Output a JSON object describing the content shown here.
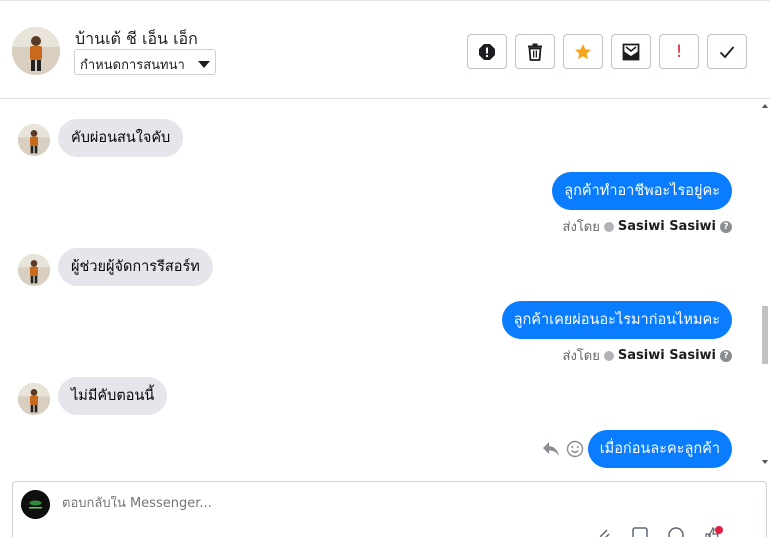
{
  "header": {
    "contact_name": "บ้านเต้ ชี เอ็น เอ็ก",
    "conversation_select": "กำหนดการสนทนา",
    "tools": [
      {
        "name": "spam-icon",
        "label": "!"
      },
      {
        "name": "trash-icon",
        "label": ""
      },
      {
        "name": "star-icon",
        "label": ""
      },
      {
        "name": "mark-unread-icon",
        "label": ""
      },
      {
        "name": "important-icon",
        "label": "!"
      },
      {
        "name": "done-icon",
        "label": ""
      }
    ]
  },
  "colors": {
    "accent": "#0a7cff",
    "incoming_bubble": "#e4e6eb",
    "star": "#f7a51c",
    "important": "#e41e3f"
  },
  "messages": [
    {
      "direction": "in",
      "text": "คับผ่อนสนใจคับ"
    },
    {
      "direction": "out",
      "text": "ลูกค้าทำอาชีพอะไรอยู่คะ",
      "sent_by_label": "ส่งโดย",
      "sender": "Sasiwi Sasiwi"
    },
    {
      "direction": "in",
      "text": "ผู้ช่วยผู้จัดการรีสอร์ท"
    },
    {
      "direction": "out",
      "text": "ลูกค้าเคยผ่อนอะไรมาก่อนไหมคะ",
      "sent_by_label": "ส่งโดย",
      "sender": "Sasiwi Sasiwi"
    },
    {
      "direction": "in",
      "text": "ไม่มีคับตอนนี้"
    },
    {
      "direction": "out",
      "text": "เมื่อก่อนละคะลูกค้า"
    }
  ],
  "composer": {
    "placeholder": "ตอบกลับใน Messenger..."
  }
}
